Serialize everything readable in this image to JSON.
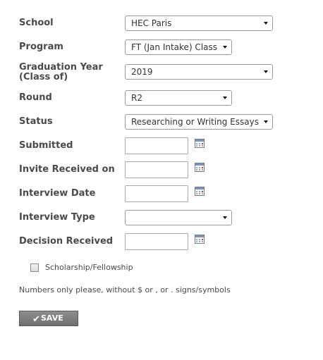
{
  "form": {
    "school": {
      "label": "School",
      "value": "HEC Paris"
    },
    "program": {
      "label": "Program",
      "value": "FT (Jan Intake) Class"
    },
    "graduation_year": {
      "label_line1": "Graduation Year",
      "label_line2": "(Class of)",
      "value": "2019"
    },
    "round": {
      "label": "Round",
      "value": "R2"
    },
    "status": {
      "label": "Status",
      "value": "Researching or Writing Essays"
    },
    "submitted": {
      "label": "Submitted",
      "value": ""
    },
    "invite_received": {
      "label": "Invite Received on",
      "value": ""
    },
    "interview_date": {
      "label": "Interview Date",
      "value": ""
    },
    "interview_type": {
      "label": "Interview Type",
      "value": ""
    },
    "decision_received": {
      "label": "Decision Received",
      "value": ""
    },
    "scholarship": {
      "label": "Scholarship/Fellowship",
      "checked": false
    },
    "note": "Numbers only please, without $ or , or . signs/symbols",
    "save_label": "SAVE"
  },
  "icons": {
    "calendar": "calendar-icon",
    "dropdown": "chevron-down-icon",
    "save_check": "check-icon"
  }
}
